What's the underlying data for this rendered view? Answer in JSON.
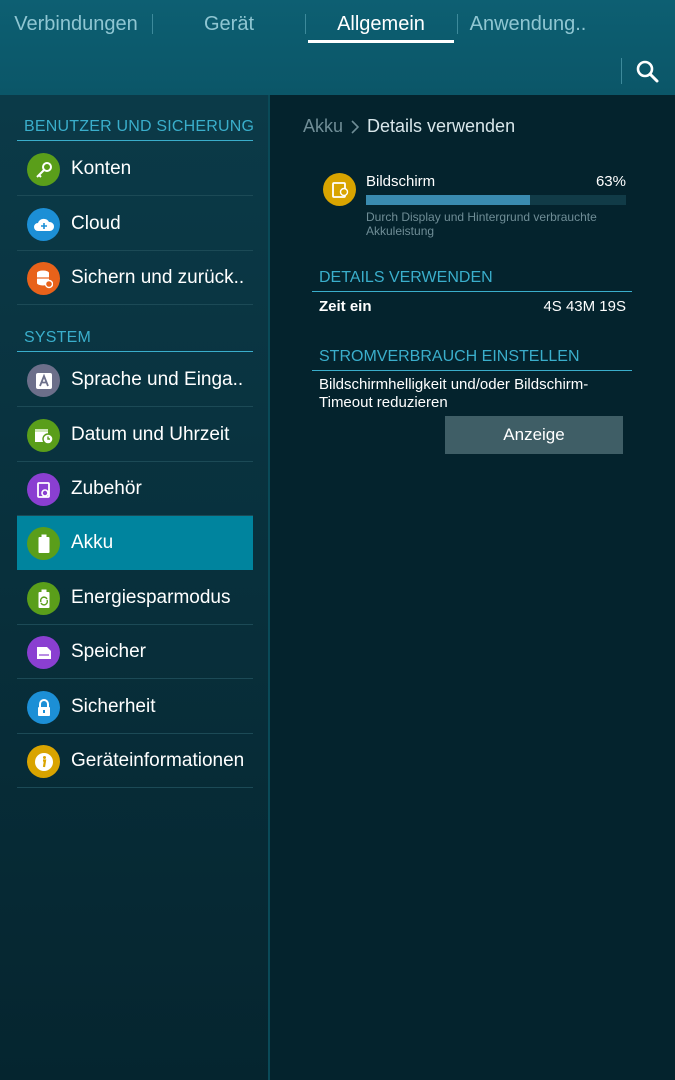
{
  "tabs": [
    {
      "label": "Verbindungen"
    },
    {
      "label": "Gerät"
    },
    {
      "label": "Allgemein"
    },
    {
      "label": "Anwendung.."
    }
  ],
  "sidebar": {
    "section1": "BENUTZER UND SICHERUNG",
    "section2": "SYSTEM",
    "items": [
      {
        "label": "Konten",
        "icon": "key-icon",
        "color": "#5a9e1a"
      },
      {
        "label": "Cloud",
        "icon": "cloud-icon",
        "color": "#1c8fd6"
      },
      {
        "label": "Sichern und zurück..",
        "icon": "backup-icon",
        "color": "#e8621a"
      },
      {
        "label": "Sprache und Einga..",
        "icon": "language-icon",
        "color": "#6c6f8a"
      },
      {
        "label": "Datum und Uhrzeit",
        "icon": "calendar-clock-icon",
        "color": "#5a9e1a"
      },
      {
        "label": "Zubehör",
        "icon": "accessory-icon",
        "color": "#8a3fd1"
      },
      {
        "label": "Akku",
        "icon": "battery-icon",
        "color": "#5a9e1a"
      },
      {
        "label": "Energiesparmodus",
        "icon": "power-saving-icon",
        "color": "#5a9e1a"
      },
      {
        "label": "Speicher",
        "icon": "storage-icon",
        "color": "#8a3fd1"
      },
      {
        "label": "Sicherheit",
        "icon": "lock-icon",
        "color": "#1c8fd6"
      },
      {
        "label": "Geräteinformationen",
        "icon": "info-icon",
        "color": "#d9a400"
      }
    ]
  },
  "breadcrumb": {
    "parent": "Akku",
    "separator": ">",
    "current": "Details verwenden"
  },
  "usage": {
    "app_name": "Bildschirm",
    "percent_text": "63%",
    "percent_value": 0.63,
    "description": "Durch Display und Hintergrund verbrauchte Akkuleistung"
  },
  "details": {
    "header": "DETAILS VERWENDEN",
    "time_label": "Zeit ein",
    "time_value": "4S 43M 19S"
  },
  "power": {
    "header": "STROMVERBRAUCH EINSTELLEN",
    "suggestion": "Bildschirmhelligkeit und/oder Bildschirm-Timeout reduzieren",
    "button_label": "Anzeige"
  },
  "colors": {
    "accent": "#3aaecb",
    "selected": "#00849e",
    "topbar": "#0d5f72",
    "progress": "#3a8bb0"
  }
}
